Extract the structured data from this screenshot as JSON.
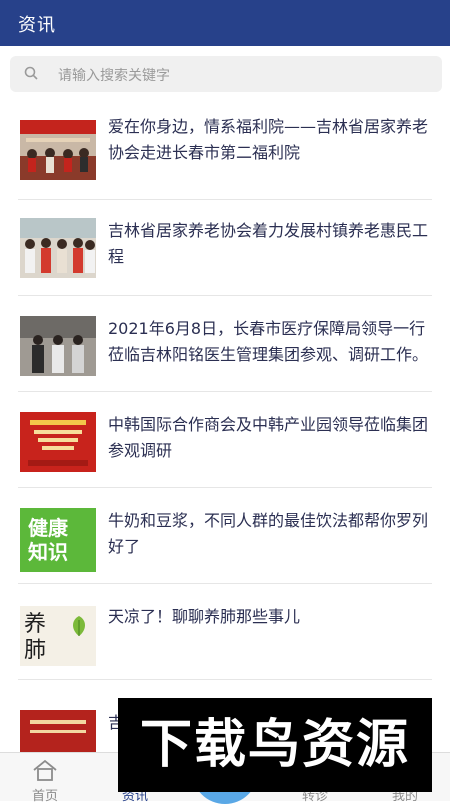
{
  "header": {
    "title": "资讯"
  },
  "search": {
    "placeholder": "请输入搜索关键字"
  },
  "news": [
    {
      "title": "爱在你身边，情系福利院——吉林省居家养老协会走进长春市第二福利院",
      "thumb_icon": "group-photo-red-banner"
    },
    {
      "title": "吉林省居家养老协会着力发展村镇养老惠民工程",
      "thumb_icon": "group-photo-sashes"
    },
    {
      "title": "2021年6月8日，长春市医疗保障局领导一行莅临吉林阳铭医生管理集团参观、调研工作。",
      "thumb_icon": "meeting-photo"
    },
    {
      "title": "中韩国际合作商会及中韩产业园领导莅临集团参观调研",
      "thumb_icon": "red-poster"
    },
    {
      "title": "牛奶和豆浆，不同人群的最佳饮法都帮你罗列好了",
      "thumb_icon": "health-knowledge-green",
      "thumb_text": "健康知识"
    },
    {
      "title": "天凉了！聊聊养肺那些事儿",
      "thumb_icon": "calligraphy-yangfei",
      "thumb_text": "养肺"
    },
    {
      "title": "吉",
      "thumb_icon": "red-document"
    }
  ],
  "tabbar": [
    {
      "label": "首页",
      "icon": "home-icon"
    },
    {
      "label": "资讯",
      "icon": "news-icon"
    },
    {
      "label": "",
      "icon": "center-icon"
    },
    {
      "label": "转诊",
      "icon": "transfer-icon"
    },
    {
      "label": "我的",
      "icon": "user-icon"
    }
  ],
  "watermark": "下载鸟资源",
  "colors": {
    "primary": "#27418a",
    "text": "#2b2f52",
    "accent": "#5aa8e6"
  }
}
